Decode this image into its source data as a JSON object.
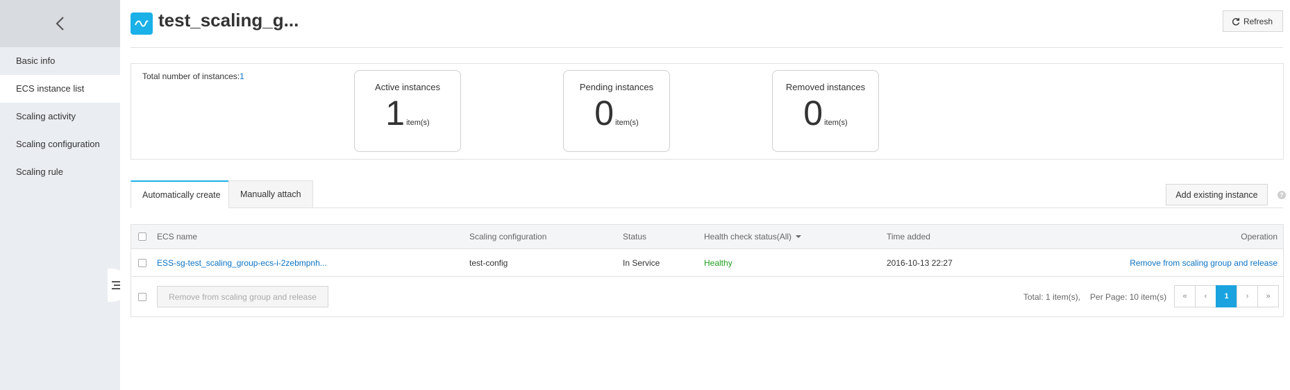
{
  "sidebar": {
    "back_icon": "chevron-left-icon",
    "items": [
      {
        "label": "Basic info",
        "active": false
      },
      {
        "label": "ECS instance list",
        "active": true
      },
      {
        "label": "Scaling activity",
        "active": false
      },
      {
        "label": "Scaling configuration",
        "active": false
      },
      {
        "label": "Scaling rule",
        "active": false
      }
    ],
    "collapse_icon": "list-toggle-icon"
  },
  "header": {
    "logo_icon": "wave-logo-icon",
    "title": "test_scaling_g...",
    "refresh_label": "Refresh",
    "refresh_icon": "refresh-icon"
  },
  "summary": {
    "total_label": "Total number of instances:",
    "total_value": "1",
    "cards": [
      {
        "label": "Active instances",
        "value": "1",
        "unit": "item(s)"
      },
      {
        "label": "Pending instances",
        "value": "0",
        "unit": "item(s)"
      },
      {
        "label": "Removed instances",
        "value": "0",
        "unit": "item(s)"
      }
    ]
  },
  "tabs": [
    {
      "label": "Automatically create",
      "active": true
    },
    {
      "label": "Manually attach",
      "active": false
    }
  ],
  "add_existing_label": "Add existing instance",
  "help_icon_text": "?",
  "table": {
    "columns": {
      "ecs_name": "ECS name",
      "scaling_configuration": "Scaling configuration",
      "status": "Status",
      "health": "Health check status(All)",
      "time_added": "Time added",
      "operation": "Operation"
    },
    "rows": [
      {
        "ecs_name": "ESS-sg-test_scaling_group-ecs-i-2zebmpnh...",
        "scaling_configuration": "test-config",
        "status": "In Service",
        "health": "Healthy",
        "time_added": "2016-10-13 22:27",
        "operation": "Remove from scaling group and release"
      }
    ],
    "batch_button": "Remove from scaling group and release",
    "pagination": {
      "total": "Total: 1 item(s),",
      "per_page": "Per Page: 10 item(s)",
      "first": "«",
      "prev": "‹",
      "current": "1",
      "next": "›",
      "last": "»"
    }
  },
  "colors": {
    "accent": "#1ab0e8",
    "link": "#0b73c6",
    "healthy": "#1e9e1e",
    "sidebar_bg": "#eaedf1"
  }
}
